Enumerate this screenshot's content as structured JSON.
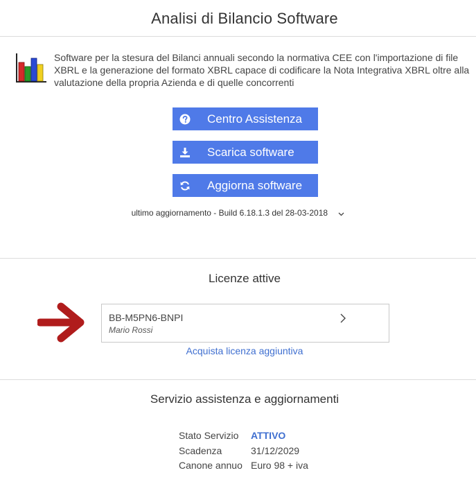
{
  "app": {
    "title": "Analisi di Bilancio Software",
    "description": "Software per la stesura del Bilanci annuali secondo la normativa CEE con l'importazione di file XBRL e la generazione del formato XBRL capace di codificare la Nota Integrativa XBRL oltre alla valutazione della propria Azienda e di quelle concorrenti",
    "logo_icon": "bar-chart-icon",
    "logo_colors": [
      "#d42a2a",
      "#2a9a2a",
      "#2a4ad4",
      "#f0d020"
    ]
  },
  "actions": {
    "support_label": "Centro Assistenza",
    "support_icon": "question-circle-icon",
    "download_label": "Scarica software",
    "download_icon": "download-icon",
    "update_label": "Aggiorna software",
    "update_icon": "refresh-icon",
    "button_color": "#4f7ae8"
  },
  "build": {
    "text": "ultimo aggiornamento - Build 6.18.1.3 del 28-03-2018",
    "toggle_icon": "chevron-down-icon"
  },
  "licenses": {
    "title": "Licenze attive",
    "items": [
      {
        "code": "BB-M5PN6-BNPI",
        "owner": "Mario Rossi"
      }
    ],
    "buy_more_label": "Acquista licenza aggiuntiva",
    "pointer_icon": "arrow-right-icon",
    "pointer_color": "#b01c1c"
  },
  "service": {
    "title": "Servizio assistenza e aggiornamenti",
    "rows": [
      {
        "label": "Stato Servizio",
        "value": "ATTIVO"
      },
      {
        "label": "Scadenza",
        "value": "31/12/2029"
      },
      {
        "label": "Canone annuo",
        "value": "Euro 98 + iva"
      }
    ],
    "active_color": "#3f6fd0"
  }
}
